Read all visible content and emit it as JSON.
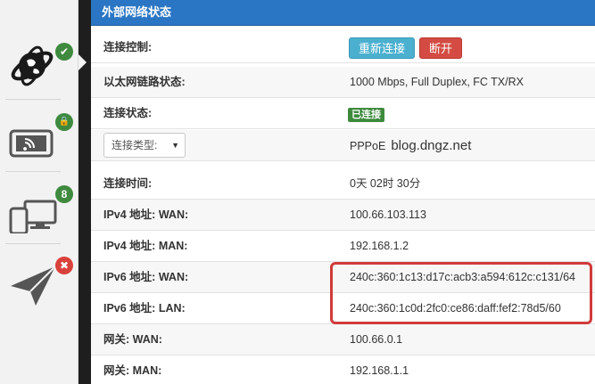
{
  "sidebar": {
    "items": [
      {
        "name": "network",
        "icon": "globe-network-icon",
        "badge": "✔",
        "badge_color": "#3f8a3e"
      },
      {
        "name": "wireless",
        "icon": "wifi-tablet-icon",
        "badge": "🔒",
        "badge_color": "#3f8a3e"
      },
      {
        "name": "devices",
        "icon": "devices-icon",
        "badge": "8",
        "badge_color": "#3f8a3e"
      },
      {
        "name": "remote",
        "icon": "paper-plane-icon",
        "badge": "✖",
        "badge_color": "#d9423b"
      }
    ]
  },
  "panel": {
    "title": "外部网络状态",
    "header_color": "#2a76c4",
    "connection_control": {
      "label": "连接控制:",
      "reconnect_label": "重新连接",
      "disconnect_label": "断开"
    },
    "ethernet_link": {
      "label": "以太网链路状态:",
      "value": "1000 Mbps, Full Duplex, FC TX/RX"
    },
    "connection_status": {
      "label": "连接状态:",
      "value": "已连接"
    },
    "connection_type": {
      "select_value": "连接类型:",
      "value": "PPPoE",
      "annotation": "blog.dngz.net"
    },
    "connection_time": {
      "label": "连接时间:",
      "value": "0天 02时 30分"
    },
    "ipv4_wan": {
      "label": "IPv4 地址: WAN:",
      "value": "100.66.103.113"
    },
    "ipv4_man": {
      "label": "IPv4 地址: MAN:",
      "value": "192.168.1.2"
    },
    "ipv6_wan": {
      "label": "IPv6 地址: WAN:",
      "value": "240c:360:1c13:d17c:acb3:a594:612c:c131/64"
    },
    "ipv6_lan": {
      "label": "IPv6 地址: LAN:",
      "value": "240c:360:1c0d:2fc0:ce86:daff:fef2:78d5/60"
    },
    "gateway_wan": {
      "label": "网关: WAN:",
      "value": "100.66.0.1"
    },
    "gateway_man": {
      "label": "网关: MAN:",
      "value": "192.168.1.1"
    }
  }
}
